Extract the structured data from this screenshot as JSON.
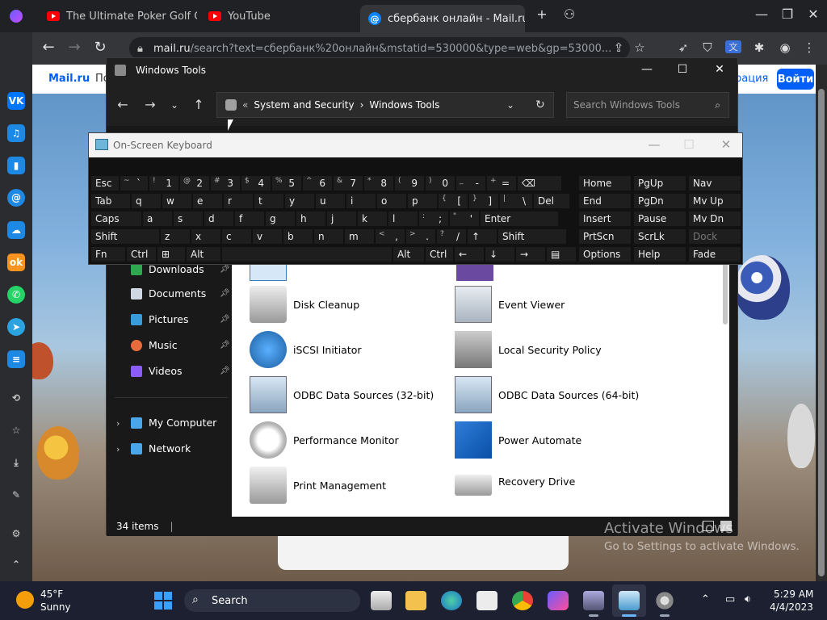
{
  "browser": {
    "tabs": [
      {
        "title": "The Ultimate Poker Golf Cha",
        "icon": "youtube-icon"
      },
      {
        "title": "YouTube",
        "icon": "youtube-icon"
      },
      {
        "title": "сбербанк онлайн - Mail.ru",
        "icon": "mailru-icon",
        "active": true
      }
    ],
    "url_domain": "mail.ru",
    "url_rest": "/search?text=сбербанк%20онлайн&mstatid=530000&type=web&gp=53000..."
  },
  "sidebar": {
    "items": [
      {
        "icon": "vk-icon",
        "letter": "VK",
        "color": "#0077ff"
      },
      {
        "icon": "music-icon",
        "letter": "♫",
        "color": "#1e88e5"
      },
      {
        "icon": "stats-icon",
        "letter": "▮",
        "color": "#1e88e5"
      },
      {
        "icon": "mail-at-icon",
        "letter": "@",
        "color": "#1e88e5"
      },
      {
        "icon": "cloud-icon",
        "letter": "☁",
        "color": "#1e88e5"
      },
      {
        "icon": "ok-icon",
        "letter": "ok",
        "color": "#f7931e"
      },
      {
        "icon": "whatsapp-icon",
        "letter": "✆",
        "color": "#25d366"
      },
      {
        "icon": "telegram-icon",
        "letter": "➤",
        "color": "#2aa3e0"
      },
      {
        "icon": "tasks-icon",
        "letter": "≡",
        "color": "#1e88e5"
      }
    ]
  },
  "webpage": {
    "logo": "Mail.ru",
    "nav_fragment": "По",
    "reg_fragment": "рация",
    "login_label": "Войти"
  },
  "explorer": {
    "title": "Windows Tools",
    "breadcrumb": [
      "System and Security",
      "Windows Tools"
    ],
    "breadcrumb_prefix": "«",
    "search_placeholder": "Search Windows Tools",
    "nav_items": [
      {
        "label": "Downloads",
        "pinned": true
      },
      {
        "label": "Documents",
        "pinned": true
      },
      {
        "label": "Pictures",
        "pinned": true
      },
      {
        "label": "Music",
        "pinned": true
      },
      {
        "label": "Videos",
        "pinned": true
      },
      {
        "label": "My Computer",
        "pinned": false
      },
      {
        "label": "Network",
        "pinned": false
      }
    ],
    "tools_left": [
      "Disk Cleanup",
      "iSCSI Initiator",
      "ODBC Data Sources (32-bit)",
      "Performance Monitor",
      "Print Management"
    ],
    "tools_right": [
      "Event Viewer",
      "Local Security Policy",
      "ODBC Data Sources (64-bit)",
      "Power Automate",
      "Recovery Drive"
    ],
    "status": "34 items"
  },
  "osk": {
    "title": "On-Screen Keyboard",
    "rows": [
      [
        [
          "Esc",
          ""
        ],
        [
          "`",
          "~"
        ],
        [
          "1",
          "!"
        ],
        [
          "2",
          "@"
        ],
        [
          "3",
          "#"
        ],
        [
          "4",
          "$"
        ],
        [
          "5",
          "%"
        ],
        [
          "6",
          "^"
        ],
        [
          "7",
          "&"
        ],
        [
          "8",
          "*"
        ],
        [
          "9",
          "("
        ],
        [
          "0",
          ")"
        ],
        [
          "-",
          "_"
        ],
        [
          "=",
          "+"
        ],
        [
          "⌫",
          ""
        ]
      ],
      [
        [
          "Tab",
          ""
        ],
        [
          "q",
          ""
        ],
        [
          "w",
          ""
        ],
        [
          "e",
          ""
        ],
        [
          "r",
          ""
        ],
        [
          "t",
          ""
        ],
        [
          "y",
          ""
        ],
        [
          "u",
          ""
        ],
        [
          "i",
          ""
        ],
        [
          "o",
          ""
        ],
        [
          "p",
          ""
        ],
        [
          "[",
          "{"
        ],
        [
          "]",
          "}"
        ],
        [
          "\\",
          "|"
        ],
        [
          "Del",
          ""
        ]
      ],
      [
        [
          "Caps",
          ""
        ],
        [
          "a",
          ""
        ],
        [
          "s",
          ""
        ],
        [
          "d",
          ""
        ],
        [
          "f",
          ""
        ],
        [
          "g",
          ""
        ],
        [
          "h",
          ""
        ],
        [
          "j",
          ""
        ],
        [
          "k",
          ""
        ],
        [
          "l",
          ""
        ],
        [
          ";",
          ":"
        ],
        [
          "'",
          "\""
        ],
        [
          "Enter",
          ""
        ]
      ],
      [
        [
          "Shift",
          ""
        ],
        [
          "z",
          ""
        ],
        [
          "x",
          ""
        ],
        [
          "c",
          ""
        ],
        [
          "v",
          ""
        ],
        [
          "b",
          ""
        ],
        [
          "n",
          ""
        ],
        [
          "m",
          ""
        ],
        [
          ",",
          "<"
        ],
        [
          ".",
          ">"
        ],
        [
          "/",
          "?"
        ],
        [
          "↑",
          ""
        ],
        [
          "Shift",
          ""
        ]
      ],
      [
        [
          "Fn",
          ""
        ],
        [
          "Ctrl",
          ""
        ],
        [
          "⊞",
          ""
        ],
        [
          "Alt",
          ""
        ],
        [
          "",
          ""
        ],
        [
          "Alt",
          ""
        ],
        [
          "Ctrl",
          ""
        ],
        [
          "←",
          ""
        ],
        [
          "↓",
          ""
        ],
        [
          "→",
          ""
        ],
        [
          "▤",
          ""
        ]
      ]
    ],
    "nav_keys": [
      [
        "Home",
        "PgUp",
        "Nav"
      ],
      [
        "End",
        "PgDn",
        "Mv Up"
      ],
      [
        "Insert",
        "Pause",
        "Mv Dn"
      ],
      [
        "PrtScn",
        "ScrLk",
        "Dock"
      ],
      [
        "Options",
        "Help",
        "Fade"
      ]
    ]
  },
  "watermark": {
    "line1": "Activate Windows",
    "line2": "Go to Settings to activate Windows."
  },
  "taskbar": {
    "temp": "45°F",
    "condition": "Sunny",
    "search_label": "Search",
    "time": "5:29 AM",
    "date": "4/4/2023"
  }
}
